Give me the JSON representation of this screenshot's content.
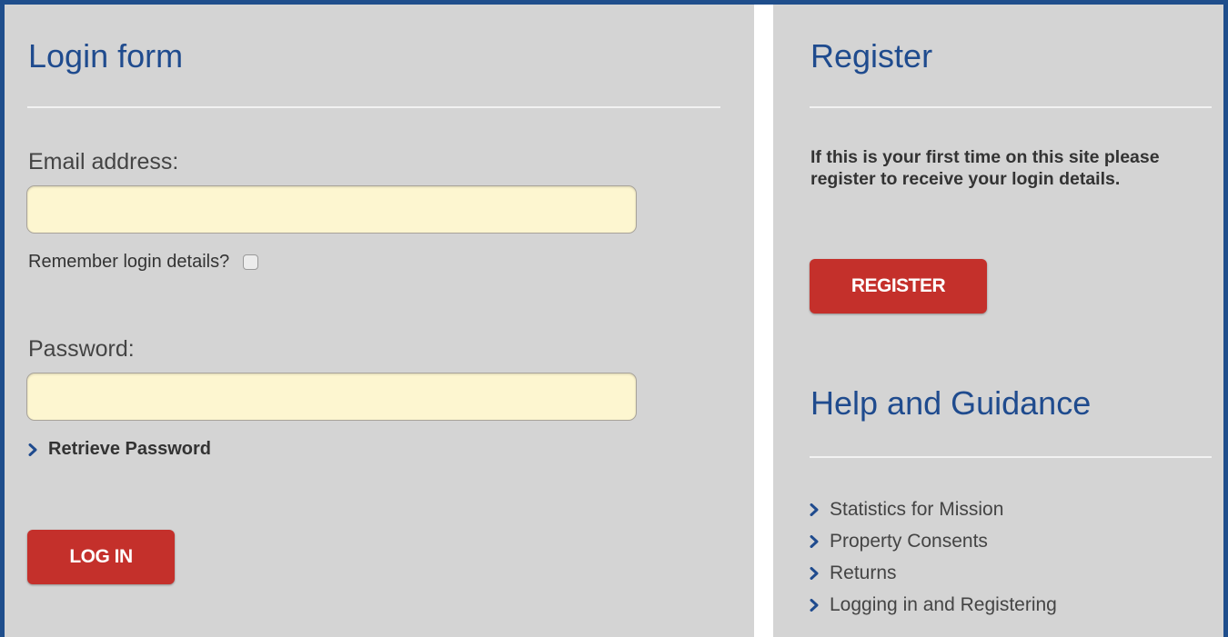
{
  "login": {
    "title": "Login form",
    "email_label": "Email address:",
    "email_value": "",
    "remember_label": "Remember login details?",
    "remember_checked": false,
    "password_label": "Password:",
    "password_value": "",
    "retrieve_link": "Retrieve Password",
    "login_button": "LOG IN"
  },
  "register": {
    "title": "Register",
    "text": "If this is your first time on this site please register to receive your login details.",
    "button": "REGISTER"
  },
  "help": {
    "title": "Help and Guidance",
    "links": [
      "Statistics for Mission",
      "Property Consents",
      "Returns",
      "Logging in and Registering"
    ]
  },
  "colors": {
    "frame_border": "#1f4e8c",
    "panel_bg": "#d4d4d4",
    "heading": "#1f4b8e",
    "button": "#c4302b",
    "input_bg": "#fdf6d0",
    "chevron": "#1f4b8e"
  },
  "icons": {
    "link_bullet": "chevron-right-icon"
  }
}
